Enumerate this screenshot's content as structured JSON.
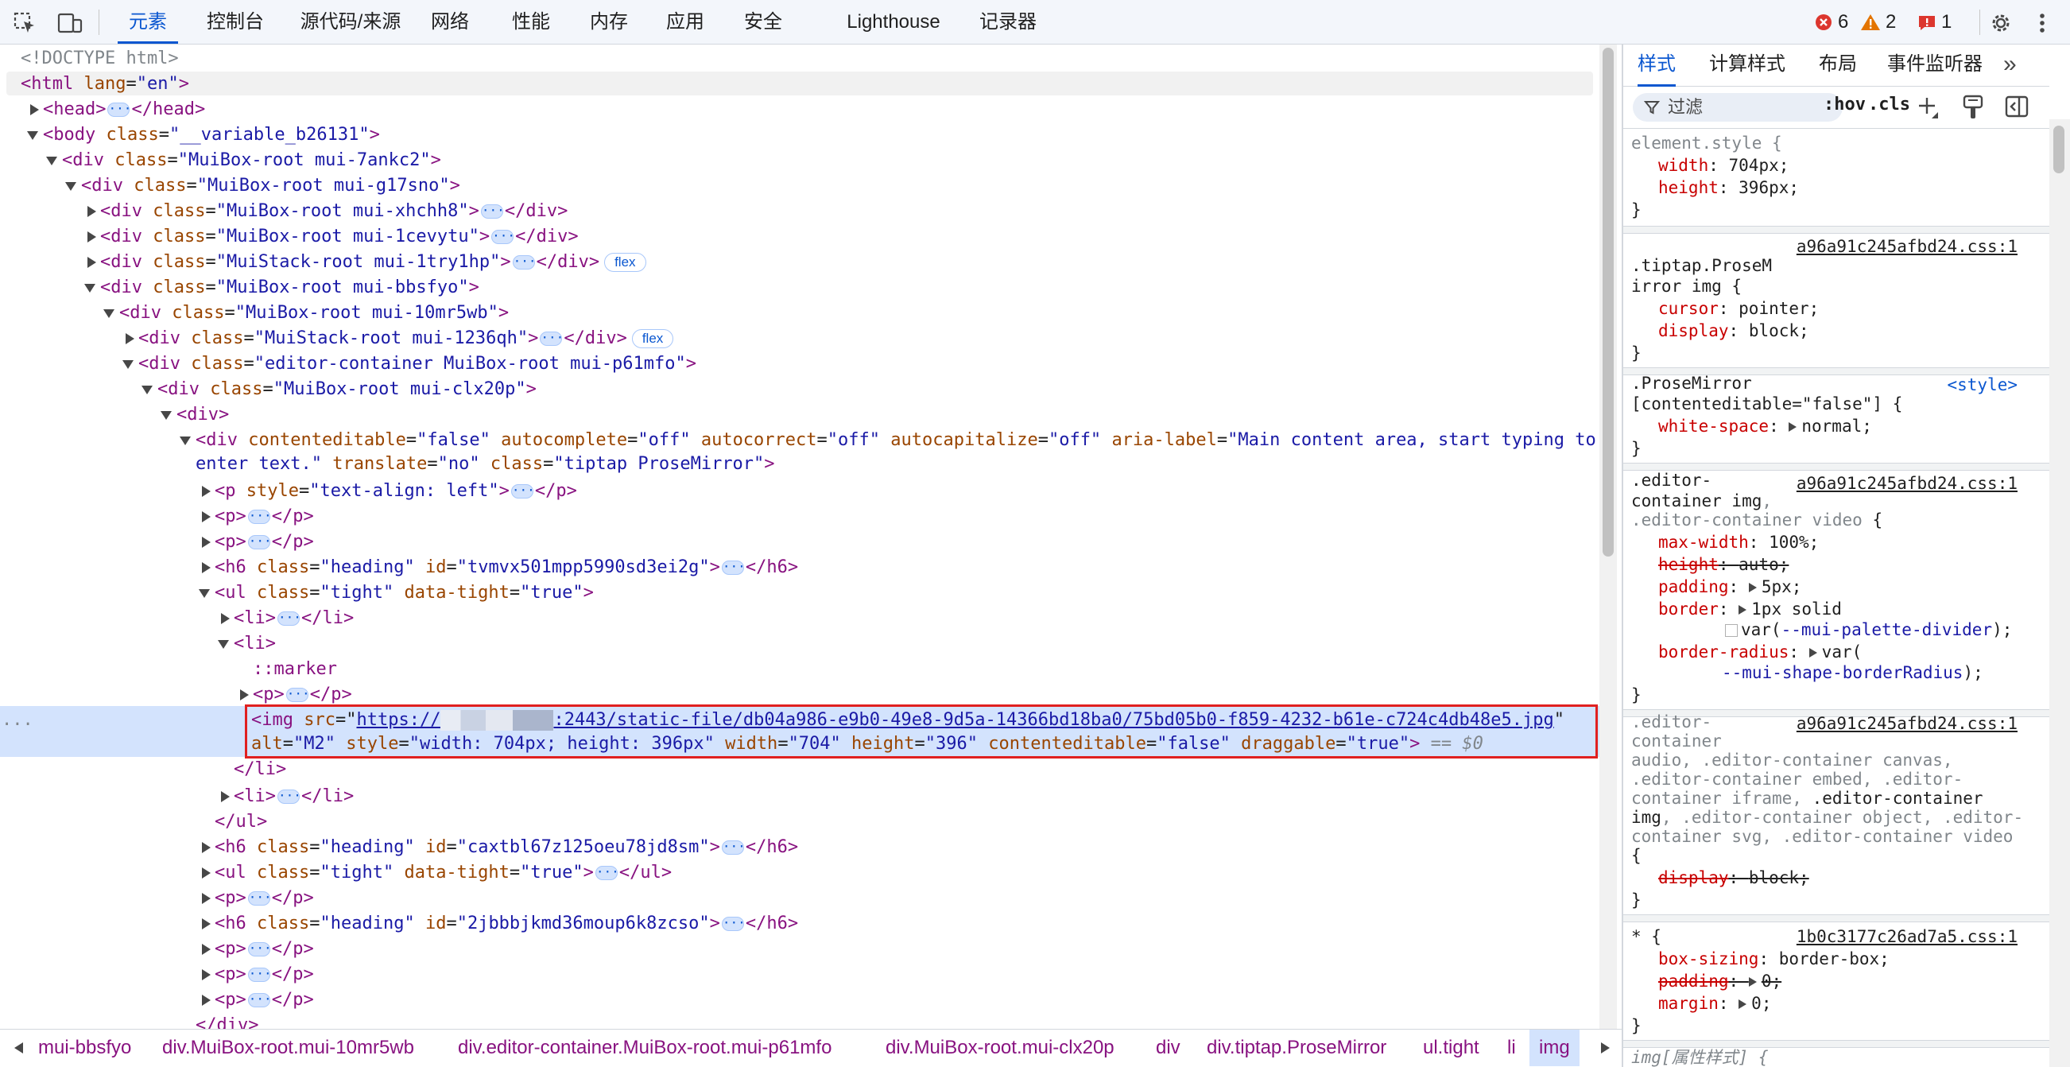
{
  "toolbar": {
    "tabs": [
      "元素",
      "控制台",
      "源代码/来源",
      "网络",
      "性能",
      "内存",
      "应用",
      "安全",
      "Lighthouse",
      "记录器"
    ],
    "active_tab": "元素",
    "errors_count": "6",
    "warnings_count": "2",
    "issues_count": "1",
    "colors": {
      "accent": "#0b57d0",
      "error": "#dc362e",
      "warning": "#e37400"
    }
  },
  "dom": {
    "doctype": "<!DOCTYPE html>",
    "html": {
      "tag": "html",
      "a1": "lang",
      "v1": "\"en\""
    },
    "head": {
      "tag": "head"
    },
    "body": {
      "tag": "body",
      "a1": "class",
      "v1": "\"__variable_b26131\""
    },
    "div1": {
      "v1": "\"MuiBox-root mui-7ankc2\""
    },
    "div2": {
      "v1": "\"MuiBox-root mui-g17sno\""
    },
    "div3": {
      "v1": "\"MuiBox-root mui-xhchh8\""
    },
    "div4": {
      "v1": "\"MuiBox-root mui-1cevytu\""
    },
    "div5": {
      "v1": "\"MuiStack-root mui-1try1hp\"",
      "badge": "flex"
    },
    "div6": {
      "v1": "\"MuiBox-root mui-bbsfyo\""
    },
    "div7": {
      "v1": "\"MuiBox-root mui-10mr5wb\""
    },
    "div8": {
      "v1": "\"MuiStack-root mui-1236qh\"",
      "badge": "flex"
    },
    "div9": {
      "v1": "\"editor-container MuiBox-root mui-p61mfo\""
    },
    "div10": {
      "v1": "\"MuiBox-root mui-clx20p\""
    },
    "editor": {
      "v_ce": "\"false\"",
      "v_ac": "\"off\"",
      "v_acr": "\"off\"",
      "v_acap": "\"off\"",
      "v_aria_1": "\"Main content area, start typing to",
      "v_aria_2": "enter text.\"",
      "v_tr": "\"no\"",
      "v_cls": "\"tiptap ProseMirror\""
    },
    "p_left": {
      "v1": "\"text-align: left\""
    },
    "h6_1": {
      "v1": "\"heading\"",
      "v2": "\"tvmvx501mpp5990sd3ei2g\""
    },
    "ul1": {
      "v1": "\"tight\"",
      "v2": "\"true\""
    },
    "marker": "::marker",
    "img": {
      "src_prefix": "https://",
      "src_suffix": ":2443/static-file/db04a986-e9b0-49e8-9d5a-14366bd18ba0/75bd05b0-f859-4232-b61e-c724c4db48e5.jpg",
      "alt": "\"M2\"",
      "style": "\"width: 704px; height: 396px\"",
      "width": "\"704\"",
      "height": "\"396\"",
      "ce": "\"false\"",
      "draggable": "\"true\"",
      "eq": "== $0"
    },
    "h6_2": {
      "v1": "\"heading\"",
      "v2": "\"caxtbl67z125oeu78jd8sm\""
    },
    "ul2": {
      "v1": "\"tight\"",
      "v2": "\"true\""
    },
    "h6_3": {
      "v1": "\"heading\"",
      "v2": "\"2jbbbjkmd36moup6k8zcso\""
    },
    "row_dots": "···"
  },
  "styles": {
    "tabs": [
      "样式",
      "计算样式",
      "布局",
      "事件监听器"
    ],
    "more": "»",
    "filter_placeholder": "过滤",
    "hov": ":hov",
    "cls": ".cls",
    "rules": {
      "r1": {
        "sel": "element.style {",
        "p1": "width",
        "v1": "704px",
        "p2": "height",
        "v2": "396px",
        "close": "}"
      },
      "r2": {
        "src": "a96a91c245afbd24.css:1",
        "sel1": ".tiptap.ProseM",
        "sel2": "irror img {",
        "p1": "cursor",
        "v1": "pointer",
        "p2": "display",
        "v2": "block",
        "close": "}"
      },
      "r3": {
        "src": "<style>",
        "sel1": ".ProseMirror",
        "sel2": "[contenteditable=\"false\"] {",
        "p1": "white-space",
        "v1": "normal",
        "close": "}"
      },
      "r4": {
        "src": "a96a91c245afbd24.css:1",
        "sel1": ".editor-",
        "sel2": "container img",
        "sel2b": ",",
        "sel3": ".editor-container video",
        "sel3b": " {",
        "p1": "max-width",
        "v1": "100%",
        "p2": "height",
        "v2": "auto",
        "p3": "padding",
        "v3": "5px",
        "p4": "border",
        "v4a": "1px solid",
        "v4b": "var(",
        "v4c": "--mui-palette-divider",
        "v4d": ");",
        "p5": "border-radius",
        "v5a": "var(",
        "v5b": "--mui-shape-borderRadius",
        "v5c": ");",
        "close": "}"
      },
      "r5": {
        "src": "a96a91c245afbd24.css:1",
        "l1": ".editor-",
        "l2": "container",
        "l3": "audio, .editor-container canvas,",
        "l4": ".editor-container embed, .editor-",
        "l5a": "container iframe, ",
        "l5b": ".editor-container",
        "l6a": "img",
        "l6b": ", .editor-container object, .editor-",
        "l7": "container svg, .editor-container video",
        "l8": "{",
        "p1": "display",
        "v1": "block",
        "close": "}"
      },
      "r6": {
        "src": "1b0c3177c26ad7a5.css:1",
        "sel": "* {",
        "p1": "box-sizing",
        "v1": "border-box",
        "p2": "padding",
        "v2": "0",
        "p3": "margin",
        "v3": "0",
        "close": "}"
      },
      "r7": {
        "sel": "img[属性样式] {"
      }
    }
  },
  "breadcrumbs": [
    "mui-bbsfyo",
    "div.MuiBox-root.mui-10mr5wb",
    "div.editor-container.MuiBox-root.mui-p61mfo",
    "div.MuiBox-root.mui-clx20p",
    "div",
    "div.tiptap.ProseMirror",
    "ul.tight",
    "li",
    "img"
  ]
}
